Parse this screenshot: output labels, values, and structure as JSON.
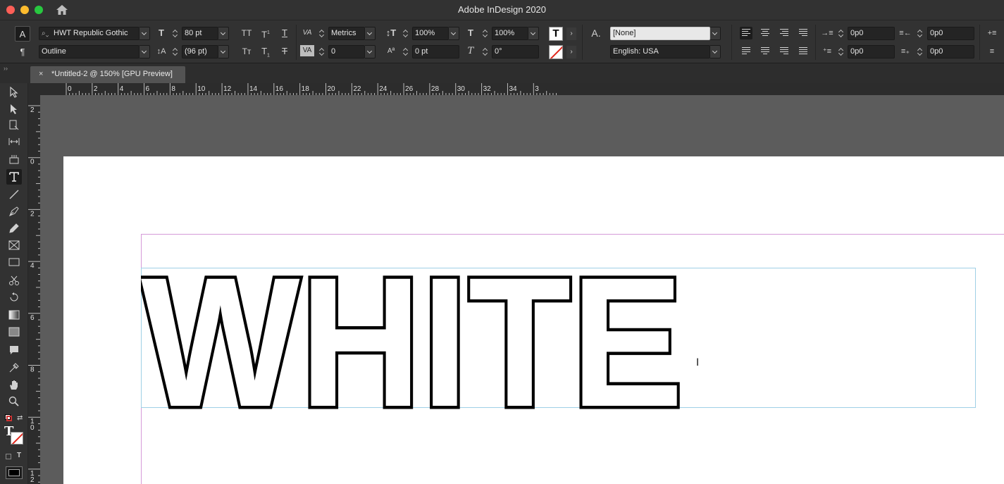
{
  "window": {
    "app_title": "Adobe InDesign 2020"
  },
  "control_panel": {
    "char_mode_icon": "A",
    "para_mode_icon": "¶",
    "font_family": "HWT Republic Gothic",
    "font_style": "Outline",
    "font_size": "80 pt",
    "leading": "(96 pt)",
    "kerning": "Metrics",
    "tracking": "0",
    "vertical_scale": "100%",
    "horizontal_scale": "100%",
    "baseline_shift": "0 pt",
    "skew": "0°",
    "character_style": "[None]",
    "language": "English: USA",
    "left_indent": "0p0",
    "right_indent": "0p0",
    "first_line_indent": "0p0",
    "last_line_indent": "0p0",
    "allcaps_label": "TT",
    "superscript_label": "T",
    "underline_label": "T",
    "smallcaps_label": "Tт",
    "subscript_label": "T",
    "strike_label": "T",
    "fill_swatch_label": "T",
    "char_style_icon_label": "A."
  },
  "document_tab": {
    "title": "*Untitled-2 @ 150% [GPU Preview]",
    "close": "×"
  },
  "rulers": {
    "horizontal_ticks": [
      "0",
      "2",
      "4",
      "6",
      "8",
      "10",
      "12",
      "14",
      "16",
      "18",
      "20",
      "22",
      "24",
      "26",
      "28",
      "30",
      "32",
      "34",
      "3"
    ],
    "vertical_ticks": [
      "2",
      "0",
      "2",
      "4",
      "6",
      "8",
      "1 0",
      "1 2"
    ]
  },
  "canvas": {
    "text_frame_content": "WHITE",
    "text_fill_color": "#ffffff",
    "text_stroke_color": "#000000"
  },
  "colors": {
    "ui_dark": "#323232",
    "pasteboard": "#5c5c5c",
    "margin_guide": "#d59ad8",
    "frame_edge": "#9fd0e6"
  }
}
